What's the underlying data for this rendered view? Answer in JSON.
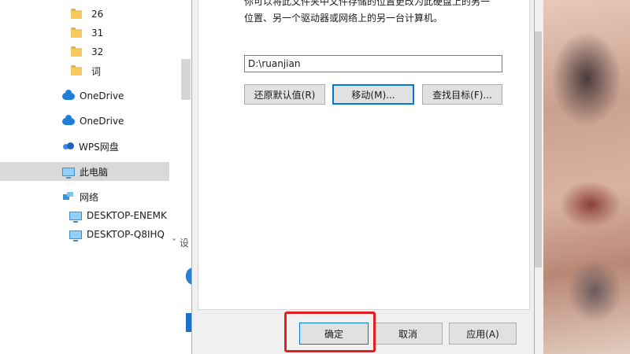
{
  "nav": {
    "items": [
      {
        "label": "26",
        "icon": "folder-icon"
      },
      {
        "label": "31",
        "icon": "folder-icon"
      },
      {
        "label": "32",
        "icon": "folder-icon"
      },
      {
        "label": "词",
        "icon": "folder-icon"
      },
      {
        "label": "OneDrive",
        "icon": "onedrive-cloud-icon"
      },
      {
        "label": "OneDrive",
        "icon": "onedrive-cloud-icon"
      },
      {
        "label": "WPS网盘",
        "icon": "wps-cloud-icon"
      },
      {
        "label": "此电脑",
        "icon": "this-pc-icon",
        "selected": true
      },
      {
        "label": "网络",
        "icon": "network-icon"
      },
      {
        "label": "DESKTOP-ENEMK",
        "icon": "computer-icon"
      },
      {
        "label": "DESKTOP-Q8IHQ",
        "icon": "computer-icon"
      }
    ]
  },
  "background": {
    "partial_text": "ˇ 设"
  },
  "dialog": {
    "description_line1": "你可以将此文件夹中文件存储的位置更改为此硬盘上的另一",
    "description_line2": "位置、另一个驱动器或网络上的另一台计算机。",
    "path_value": "D:\\ruanjian",
    "restore_default_label": "还原默认值(R)",
    "move_label": "移动(M)...",
    "find_target_label": "查找目标(F)...",
    "ok_label": "确定",
    "cancel_label": "取消",
    "apply_label": "应用(A)"
  },
  "colors": {
    "highlight": "#e02020",
    "accent": "#0078d7"
  }
}
